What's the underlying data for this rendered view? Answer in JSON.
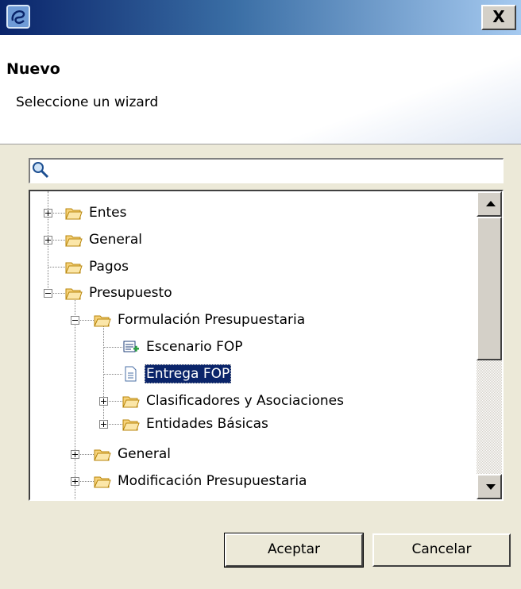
{
  "window": {
    "close_label": "X"
  },
  "header": {
    "title": "Nuevo",
    "subtitle": "Seleccione un wizard"
  },
  "search": {
    "value": "",
    "placeholder": ""
  },
  "tree": {
    "items": [
      {
        "label": "Entes",
        "icon": "folder-icon"
      },
      {
        "label": "General",
        "icon": "folder-icon"
      },
      {
        "label": "Pagos",
        "icon": "folder-icon"
      },
      {
        "label": "Presupuesto",
        "icon": "folder-icon"
      },
      {
        "label": "Formulación Presupuestaria",
        "icon": "folder-icon"
      },
      {
        "label": "Escenario FOP",
        "icon": "scenario-icon"
      },
      {
        "label": "Entrega FOP",
        "icon": "document-icon",
        "selected": true
      },
      {
        "label": "Clasificadores y Asociaciones",
        "icon": "folder-icon"
      },
      {
        "label": "Entidades Básicas",
        "icon": "folder-icon"
      },
      {
        "label": "General",
        "icon": "folder-icon"
      },
      {
        "label": "Modificación Presupuestaria",
        "icon": "folder-icon"
      }
    ]
  },
  "buttons": {
    "ok": "Aceptar",
    "cancel": "Cancelar"
  },
  "colors": {
    "titlebar": "#0a246a",
    "selection": "#0a246a",
    "face": "#ece9d8"
  }
}
